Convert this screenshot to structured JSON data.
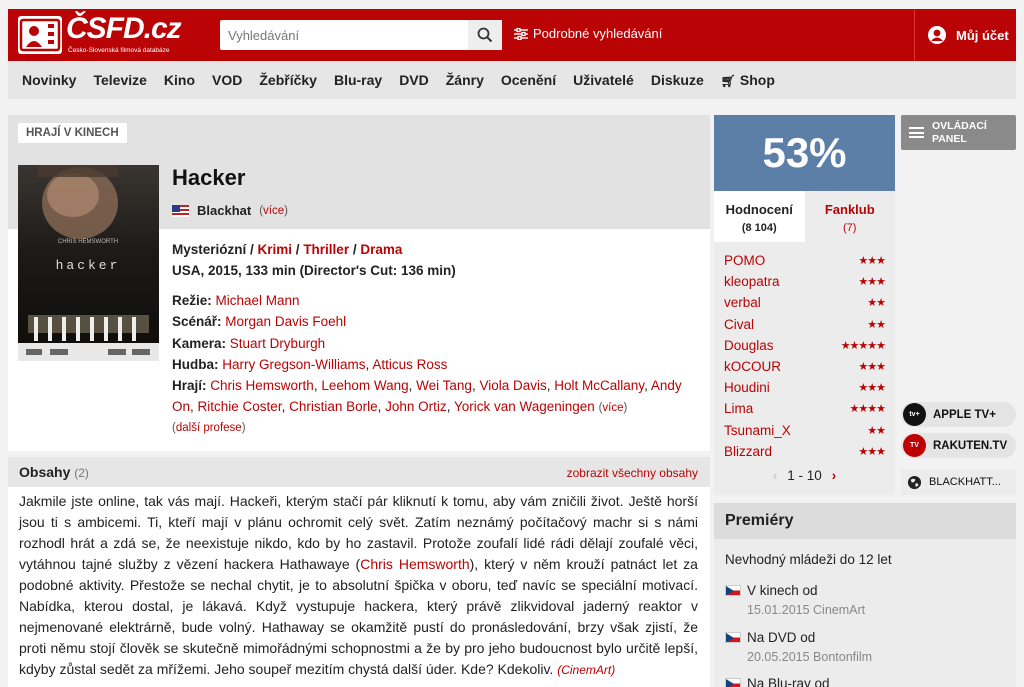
{
  "header": {
    "logo_text": "ČSFD.cz",
    "logo_sub": "Česko-Slovenská filmová databáze",
    "search_placeholder": "Vyhledávání",
    "advanced_search": "Podrobné vyhledávání",
    "account": "Můj účet"
  },
  "nav": [
    "Novinky",
    "Televize",
    "Kino",
    "VOD",
    "Žebříčky",
    "Blu-ray",
    "DVD",
    "Žánry",
    "Ocenění",
    "Uživatelé",
    "Diskuze",
    "Shop"
  ],
  "film": {
    "tag": "HRAJÍ V KINECH",
    "title": "Hacker",
    "original_title": "Blackhat",
    "more": "více",
    "genres": [
      "Mysteriózní",
      "Krimi",
      "Thriller",
      "Drama"
    ],
    "origin": "USA, 2015, 133 min (Director's Cut: 136 min)",
    "crew": {
      "director_label": "Režie:",
      "director": "Michael Mann",
      "writer_label": "Scénář:",
      "writer": "Morgan Davis Foehl",
      "camera_label": "Kamera:",
      "camera": "Stuart Dryburgh",
      "music_label": "Hudba:",
      "music": [
        "Harry Gregson-Williams",
        "Atticus Ross"
      ],
      "cast_label": "Hrají:",
      "cast": [
        "Chris Hemsworth",
        "Leehom Wang",
        "Wei Tang",
        "Viola Davis",
        "Holt McCallany",
        "Andy On",
        "Ritchie Coster",
        "Christian Borle",
        "John Ortiz",
        "Yorick van Wageningen"
      ],
      "cast_more": "více",
      "more_professions": "další profese"
    },
    "poster_text": "hacker"
  },
  "synopsis": {
    "heading": "Obsahy",
    "count": "(2)",
    "show_all": "zobrazit všechny obsahy",
    "text_1": "Jakmile jste online, tak vás mají. Hackeři, kterým stačí pár kliknutí k tomu, aby vám zničili život. Ještě horší jsou ti s ambicemi. Ti, kteří mají v plánu ochromit celý svět. Zatím neznámý počítačový machr si s námi rozhodl hrát a zdá se, že neexistuje nikdo, kdo by ho zastavil. Protože zoufalí lidé rádi dělají zoufalé věci, vytáhnou tajné služby z vězení hackera Hathawaye (",
    "text_link": "Chris Hemsworth",
    "text_2": "), který v něm krouží patnáct let za podobné aktivity. Přestože se nechal chytit, je to absolutní špička v oboru, teď navíc se speciální motivací. Nabídka, kterou dostal, je lákavá. Když vystupuje hackera, který právě zlikvidoval jaderný reaktor v nejmenované elektrárně, bude volný. Hathaway se okamžitě pustí do pronásledování, brzy však zjistí, že proti němu stojí člověk se skutečně mimořádnými schopnostmi a že by pro jeho budoucnost bylo určitě lepší, kdyby zůstal sedět za mřížemi. Jeho soupeř mezitím chystá další úder. Kde? Kdekoliv.",
    "source": "(CinemArt)"
  },
  "rating": {
    "percent": "53%",
    "tab_rating": "Hodnocení",
    "tab_rating_count": "(8 104)",
    "tab_fanclub": "Fanklub",
    "tab_fanclub_count": "(7)",
    "users": [
      {
        "name": "POMO",
        "stars": 3
      },
      {
        "name": "kleopatra",
        "stars": 3
      },
      {
        "name": "verbal",
        "stars": 2
      },
      {
        "name": "Cival",
        "stars": 2
      },
      {
        "name": "Douglas",
        "stars": 5
      },
      {
        "name": "kOCOUR",
        "stars": 3
      },
      {
        "name": "Houdini",
        "stars": 3
      },
      {
        "name": "Lima",
        "stars": 4
      },
      {
        "name": "Tsunami_X",
        "stars": 2
      },
      {
        "name": "Blizzard",
        "stars": 3
      }
    ],
    "pager": "1 - 10"
  },
  "side": {
    "panel": "OVLÁDACÍ PANEL",
    "vod": [
      {
        "label": "APPLE TV+",
        "icon": "apple-tv-icon",
        "icon_text": "tv+",
        "color": "#111111"
      },
      {
        "label": "RAKUTEN.TV",
        "icon": "rakuten-tv-icon",
        "icon_text": "TV",
        "color": "#bf0000"
      },
      {
        "label": "BLACKHATT...",
        "icon": "globe-icon",
        "icon_text": "",
        "color": "#222222"
      }
    ]
  },
  "premiery": {
    "heading": "Premiéry",
    "age": "Nevhodný mládeži do 12 let",
    "items": [
      {
        "label": "V kinech od",
        "date": "15.01.2015 CinemArt"
      },
      {
        "label": "Na DVD od",
        "date": "20.05.2015 Bontonfilm"
      },
      {
        "label": "Na Blu-ray od",
        "date": ""
      }
    ]
  },
  "colors": {
    "brand": "#ba0305",
    "rating": "#5c7fa8"
  }
}
